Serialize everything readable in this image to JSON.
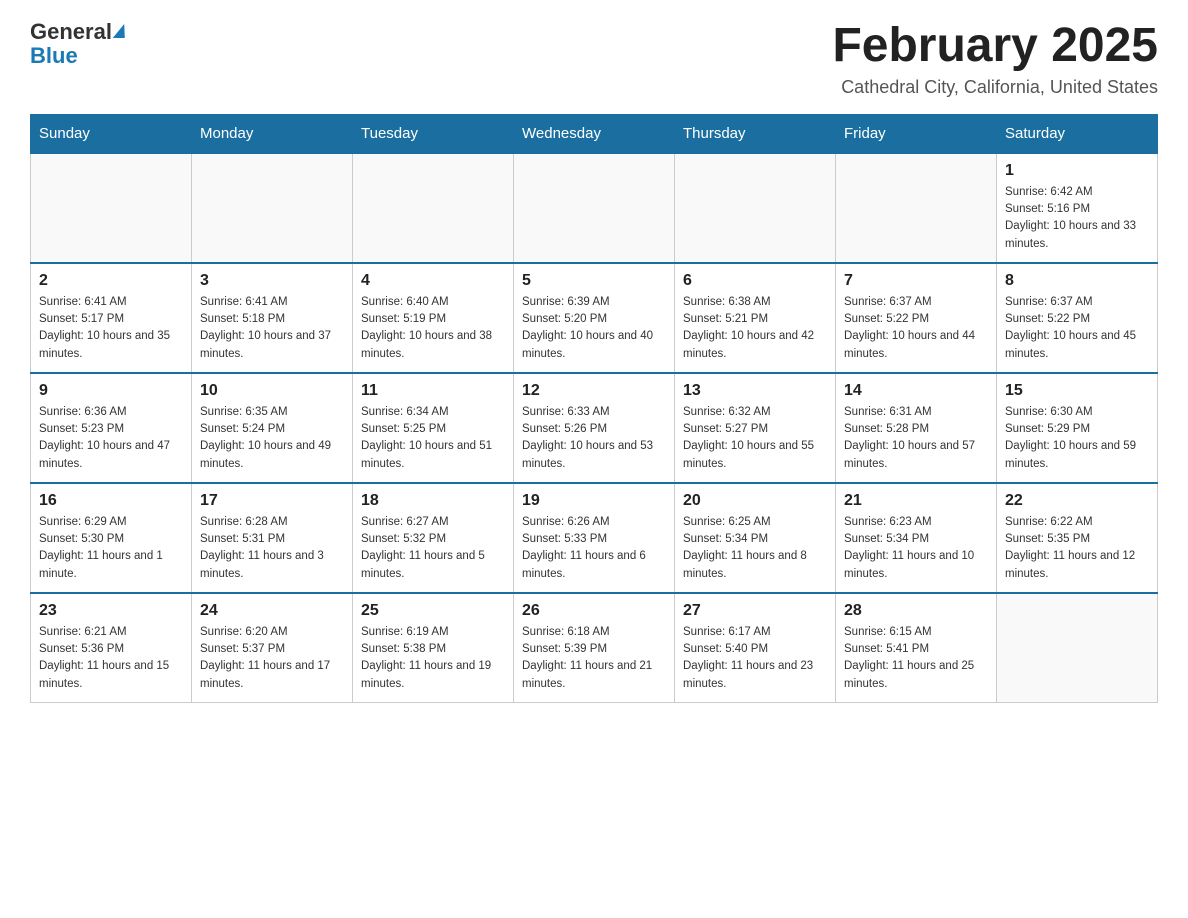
{
  "header": {
    "logo_general": "General",
    "logo_blue": "Blue",
    "month_title": "February 2025",
    "subtitle": "Cathedral City, California, United States"
  },
  "days_of_week": [
    "Sunday",
    "Monday",
    "Tuesday",
    "Wednesday",
    "Thursday",
    "Friday",
    "Saturday"
  ],
  "weeks": [
    [
      {
        "day": "",
        "sunrise": "",
        "sunset": "",
        "daylight": ""
      },
      {
        "day": "",
        "sunrise": "",
        "sunset": "",
        "daylight": ""
      },
      {
        "day": "",
        "sunrise": "",
        "sunset": "",
        "daylight": ""
      },
      {
        "day": "",
        "sunrise": "",
        "sunset": "",
        "daylight": ""
      },
      {
        "day": "",
        "sunrise": "",
        "sunset": "",
        "daylight": ""
      },
      {
        "day": "",
        "sunrise": "",
        "sunset": "",
        "daylight": ""
      },
      {
        "day": "1",
        "sunrise": "Sunrise: 6:42 AM",
        "sunset": "Sunset: 5:16 PM",
        "daylight": "Daylight: 10 hours and 33 minutes."
      }
    ],
    [
      {
        "day": "2",
        "sunrise": "Sunrise: 6:41 AM",
        "sunset": "Sunset: 5:17 PM",
        "daylight": "Daylight: 10 hours and 35 minutes."
      },
      {
        "day": "3",
        "sunrise": "Sunrise: 6:41 AM",
        "sunset": "Sunset: 5:18 PM",
        "daylight": "Daylight: 10 hours and 37 minutes."
      },
      {
        "day": "4",
        "sunrise": "Sunrise: 6:40 AM",
        "sunset": "Sunset: 5:19 PM",
        "daylight": "Daylight: 10 hours and 38 minutes."
      },
      {
        "day": "5",
        "sunrise": "Sunrise: 6:39 AM",
        "sunset": "Sunset: 5:20 PM",
        "daylight": "Daylight: 10 hours and 40 minutes."
      },
      {
        "day": "6",
        "sunrise": "Sunrise: 6:38 AM",
        "sunset": "Sunset: 5:21 PM",
        "daylight": "Daylight: 10 hours and 42 minutes."
      },
      {
        "day": "7",
        "sunrise": "Sunrise: 6:37 AM",
        "sunset": "Sunset: 5:22 PM",
        "daylight": "Daylight: 10 hours and 44 minutes."
      },
      {
        "day": "8",
        "sunrise": "Sunrise: 6:37 AM",
        "sunset": "Sunset: 5:22 PM",
        "daylight": "Daylight: 10 hours and 45 minutes."
      }
    ],
    [
      {
        "day": "9",
        "sunrise": "Sunrise: 6:36 AM",
        "sunset": "Sunset: 5:23 PM",
        "daylight": "Daylight: 10 hours and 47 minutes."
      },
      {
        "day": "10",
        "sunrise": "Sunrise: 6:35 AM",
        "sunset": "Sunset: 5:24 PM",
        "daylight": "Daylight: 10 hours and 49 minutes."
      },
      {
        "day": "11",
        "sunrise": "Sunrise: 6:34 AM",
        "sunset": "Sunset: 5:25 PM",
        "daylight": "Daylight: 10 hours and 51 minutes."
      },
      {
        "day": "12",
        "sunrise": "Sunrise: 6:33 AM",
        "sunset": "Sunset: 5:26 PM",
        "daylight": "Daylight: 10 hours and 53 minutes."
      },
      {
        "day": "13",
        "sunrise": "Sunrise: 6:32 AM",
        "sunset": "Sunset: 5:27 PM",
        "daylight": "Daylight: 10 hours and 55 minutes."
      },
      {
        "day": "14",
        "sunrise": "Sunrise: 6:31 AM",
        "sunset": "Sunset: 5:28 PM",
        "daylight": "Daylight: 10 hours and 57 minutes."
      },
      {
        "day": "15",
        "sunrise": "Sunrise: 6:30 AM",
        "sunset": "Sunset: 5:29 PM",
        "daylight": "Daylight: 10 hours and 59 minutes."
      }
    ],
    [
      {
        "day": "16",
        "sunrise": "Sunrise: 6:29 AM",
        "sunset": "Sunset: 5:30 PM",
        "daylight": "Daylight: 11 hours and 1 minute."
      },
      {
        "day": "17",
        "sunrise": "Sunrise: 6:28 AM",
        "sunset": "Sunset: 5:31 PM",
        "daylight": "Daylight: 11 hours and 3 minutes."
      },
      {
        "day": "18",
        "sunrise": "Sunrise: 6:27 AM",
        "sunset": "Sunset: 5:32 PM",
        "daylight": "Daylight: 11 hours and 5 minutes."
      },
      {
        "day": "19",
        "sunrise": "Sunrise: 6:26 AM",
        "sunset": "Sunset: 5:33 PM",
        "daylight": "Daylight: 11 hours and 6 minutes."
      },
      {
        "day": "20",
        "sunrise": "Sunrise: 6:25 AM",
        "sunset": "Sunset: 5:34 PM",
        "daylight": "Daylight: 11 hours and 8 minutes."
      },
      {
        "day": "21",
        "sunrise": "Sunrise: 6:23 AM",
        "sunset": "Sunset: 5:34 PM",
        "daylight": "Daylight: 11 hours and 10 minutes."
      },
      {
        "day": "22",
        "sunrise": "Sunrise: 6:22 AM",
        "sunset": "Sunset: 5:35 PM",
        "daylight": "Daylight: 11 hours and 12 minutes."
      }
    ],
    [
      {
        "day": "23",
        "sunrise": "Sunrise: 6:21 AM",
        "sunset": "Sunset: 5:36 PM",
        "daylight": "Daylight: 11 hours and 15 minutes."
      },
      {
        "day": "24",
        "sunrise": "Sunrise: 6:20 AM",
        "sunset": "Sunset: 5:37 PM",
        "daylight": "Daylight: 11 hours and 17 minutes."
      },
      {
        "day": "25",
        "sunrise": "Sunrise: 6:19 AM",
        "sunset": "Sunset: 5:38 PM",
        "daylight": "Daylight: 11 hours and 19 minutes."
      },
      {
        "day": "26",
        "sunrise": "Sunrise: 6:18 AM",
        "sunset": "Sunset: 5:39 PM",
        "daylight": "Daylight: 11 hours and 21 minutes."
      },
      {
        "day": "27",
        "sunrise": "Sunrise: 6:17 AM",
        "sunset": "Sunset: 5:40 PM",
        "daylight": "Daylight: 11 hours and 23 minutes."
      },
      {
        "day": "28",
        "sunrise": "Sunrise: 6:15 AM",
        "sunset": "Sunset: 5:41 PM",
        "daylight": "Daylight: 11 hours and 25 minutes."
      },
      {
        "day": "",
        "sunrise": "",
        "sunset": "",
        "daylight": ""
      }
    ]
  ]
}
